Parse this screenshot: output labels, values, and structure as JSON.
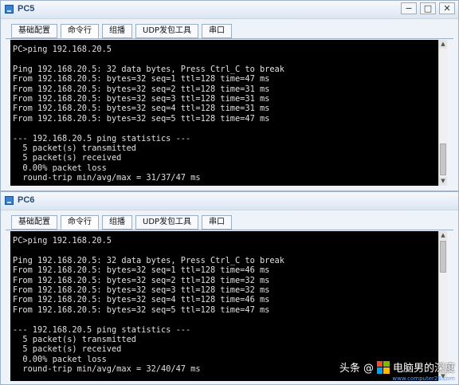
{
  "windows": [
    {
      "title": "PC5",
      "controls": {
        "minimize": "−",
        "restore": "□",
        "close": "✕"
      },
      "tabs": [
        "基础配置",
        "命令行",
        "组播",
        "UDP发包工具",
        "串口"
      ],
      "active_tab": "命令行",
      "console_lines": [
        "PC>ping 192.168.20.5",
        "",
        "Ping 192.168.20.5: 32 data bytes, Press Ctrl_C to break",
        "From 192.168.20.5: bytes=32 seq=1 ttl=128 time=47 ms",
        "From 192.168.20.5: bytes=32 seq=2 ttl=128 time=31 ms",
        "From 192.168.20.5: bytes=32 seq=3 ttl=128 time=31 ms",
        "From 192.168.20.5: bytes=32 seq=4 ttl=128 time=31 ms",
        "From 192.168.20.5: bytes=32 seq=5 ttl=128 time=47 ms",
        "",
        "--- 192.168.20.5 ping statistics ---",
        "  5 packet(s) transmitted",
        "  5 packet(s) received",
        "  0.00% packet loss",
        "  round-trip min/avg/max = 31/37/47 ms"
      ]
    },
    {
      "title": "PC6",
      "controls": {
        "minimize": "−",
        "restore": "□",
        "close": "✕"
      },
      "tabs": [
        "基础配置",
        "命令行",
        "组播",
        "UDP发包工具",
        "串口"
      ],
      "active_tab": "命令行",
      "console_lines": [
        "PC>ping 192.168.20.5",
        "",
        "Ping 192.168.20.5: 32 data bytes, Press Ctrl_C to break",
        "From 192.168.20.5: bytes=32 seq=1 ttl=128 time=46 ms",
        "From 192.168.20.5: bytes=32 seq=2 ttl=128 time=32 ms",
        "From 192.168.20.5: bytes=32 seq=3 ttl=128 time=32 ms",
        "From 192.168.20.5: bytes=32 seq=4 ttl=128 time=46 ms",
        "From 192.168.20.5: bytes=32 seq=5 ttl=128 time=47 ms",
        "",
        "--- 192.168.20.5 ping statistics ---",
        "  5 packet(s) transmitted",
        "  5 packet(s) received",
        "  0.00% packet loss",
        "  round-trip min/avg/max = 32/40/47 ms"
      ]
    }
  ],
  "watermark": {
    "text": "头条 @",
    "author": "电脑男的深度",
    "site": "www.computer26.com",
    "logo_colors": [
      "#f25022",
      "#7fba00",
      "#00a4ef",
      "#ffb900"
    ]
  },
  "colors": {
    "console_bg": "#000000",
    "console_fg": "#e0e0e0",
    "window_bg": "#eef3fa",
    "title_text": "#2a4a78"
  }
}
